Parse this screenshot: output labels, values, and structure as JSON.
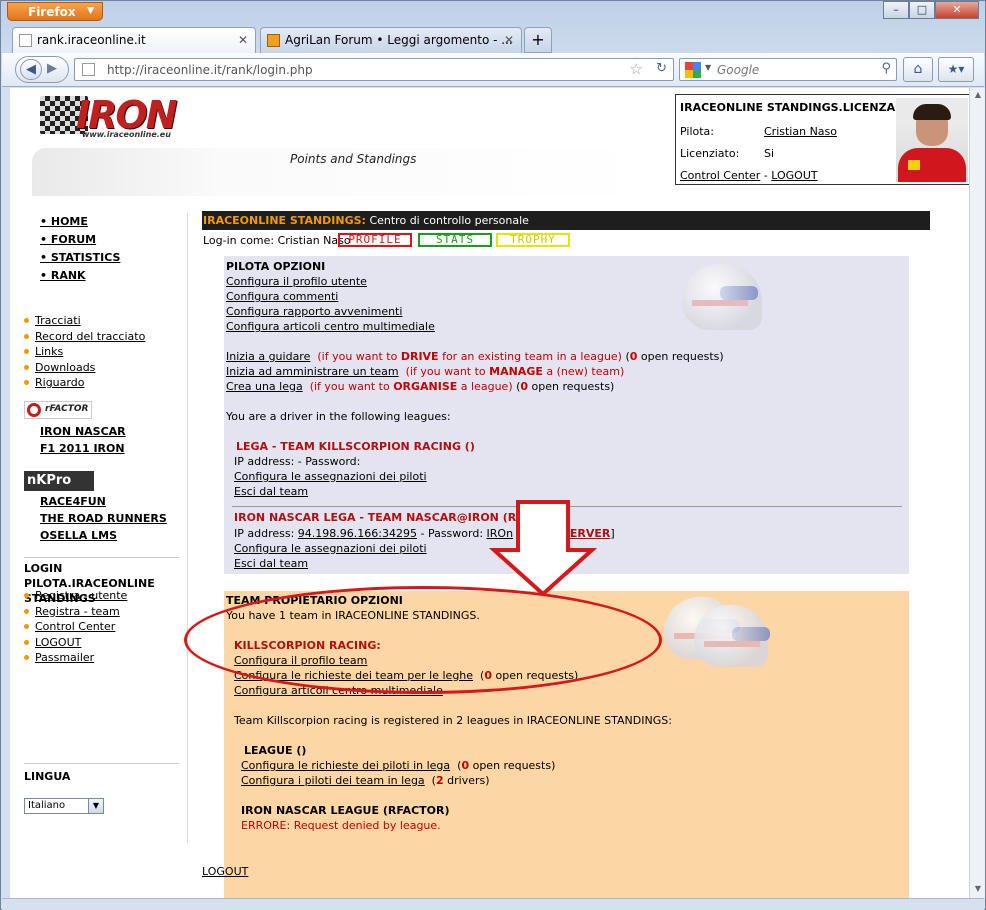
{
  "browser": {
    "app_button": "Firefox",
    "tabs": [
      {
        "label": "rank.iraceonline.it",
        "active": true
      },
      {
        "label": "AgriLan Forum • Leggi argomento - ...",
        "active": false
      }
    ],
    "new_tab": "+",
    "url": "http://iraceonline.it/rank/login.php",
    "search_placeholder": "Google"
  },
  "header": {
    "logo_text": "IRON",
    "logo_sub": "www.iraceonline.eu",
    "subtitle": "Points and Standings"
  },
  "license": {
    "title": "IRACEONLINE STANDINGS.LICENZA",
    "pilota_label": "Pilota:",
    "pilota_value": "Cristian Naso",
    "licenziato_label": "Licenziato:",
    "licenziato_value": "Si",
    "control_center": "Control Center",
    "sep": " - ",
    "logout": "LOGOUT"
  },
  "sidebar": {
    "main_menu": [
      "• HOME",
      "• FORUM",
      "• STATISTICS",
      "• RANK"
    ],
    "links": [
      "Tracciati",
      "Record del tracciato",
      "Links",
      "Downloads",
      "Riguardo"
    ],
    "rfactor_logo": "rFACTOR",
    "rfactor_leagues": [
      "IRON NASCAR",
      "F1 2011 IRON"
    ],
    "nkpro_logo": "nKPro",
    "nkpro_leagues": [
      "RACE4FUN",
      "THE ROAD RUNNERS",
      "OSELLA LMS"
    ],
    "login_title": "LOGIN PILOTA.IRACEONLINE STANDINGS",
    "login_links": [
      "Registra - utente",
      "Registra - team",
      "Control Center",
      "LOGOUT",
      "Passmailer"
    ],
    "lingua_title": "LINGUA",
    "language_selected": "Italiano"
  },
  "main": {
    "bar_title": "IRACEONLINE STANDINGS:",
    "bar_text": " Centro di controllo personale",
    "logged_as": "Log-in come: Cristian Naso",
    "buttons": [
      "PROFILE",
      "STATS",
      "TROPHY"
    ],
    "pilota": {
      "title": "PILOTA OPZIONI",
      "links": [
        "Configura il profilo utente",
        "Configura commenti",
        "Configura rapporto avvenimenti",
        "Configura articoli centro multimediale"
      ],
      "drive_link": "Inizia a guidare",
      "drive_pre": "(if you want to ",
      "drive_word": "DRIVE",
      "drive_post": " for an existing team in a league)",
      "drive_count": "0",
      "drive_tail": " open requests)",
      "manage_link": "Inizia ad amministrare un team",
      "manage_pre": "(if you want to ",
      "manage_word": "MANAGE",
      "manage_post": " a (new) team)",
      "organise_link": "Crea una lega",
      "organise_pre": "(if you want to ",
      "organise_word": "ORGANISE",
      "organise_post": " a league)",
      "organise_count": "0",
      "organise_tail": " open requests)",
      "driver_in": "You are a driver in the following leagues:",
      "league1": {
        "title": "LEGA - TEAM KILLSCORPION RACING ()",
        "ip": "IP address: - Password:",
        "assign": "Configura le assegnazioni dei piloti",
        "exit": "Esci dal team"
      },
      "league2": {
        "title": "IRON NASCAR LEGA - TEAM NASCAR@IRON (RFACTOR)",
        "ip_label": "IP address: ",
        "ip_value": "94.198.96.166:34295",
        "pw_label": " - Password: ",
        "pw_value": "IROn",
        "join": "JOIN SERVER",
        "assign": "Configura le assegnazioni dei piloti",
        "exit": "Esci dal team"
      }
    },
    "team": {
      "title": "TEAM PROPIETARIO OPZIONI",
      "count_text": "You have 1 team in IRACEONLINE STANDINGS.",
      "team_name": "KILLSCORPION RACING:",
      "links": [
        "Configura il profilo team",
        "Configura le richieste dei team per le leghe",
        "Configura articoli centro multimediale"
      ],
      "req_count": "0",
      "req_tail": " open requests)",
      "registered": "Team Killscorpion racing is registered in 2 leagues in IRACEONLINE STANDINGS:",
      "league_a": {
        "title": "LEAGUE ()",
        "l1": "Configura le richieste dei piloti in lega",
        "l1_count": "0",
        "l1_tail": " open requests)",
        "l2": "Configura i piloti dei team in lega",
        "l2_count": "2",
        "l2_tail": " drivers)"
      },
      "league_b": {
        "title": "IRON NASCAR LEAGUE (RFACTOR)",
        "error": "ERRORE: Request denied by league."
      }
    },
    "bottom_logout": "LOGOUT"
  },
  "colors": {
    "accent": "#f29a00",
    "annotation": "#d81818"
  }
}
